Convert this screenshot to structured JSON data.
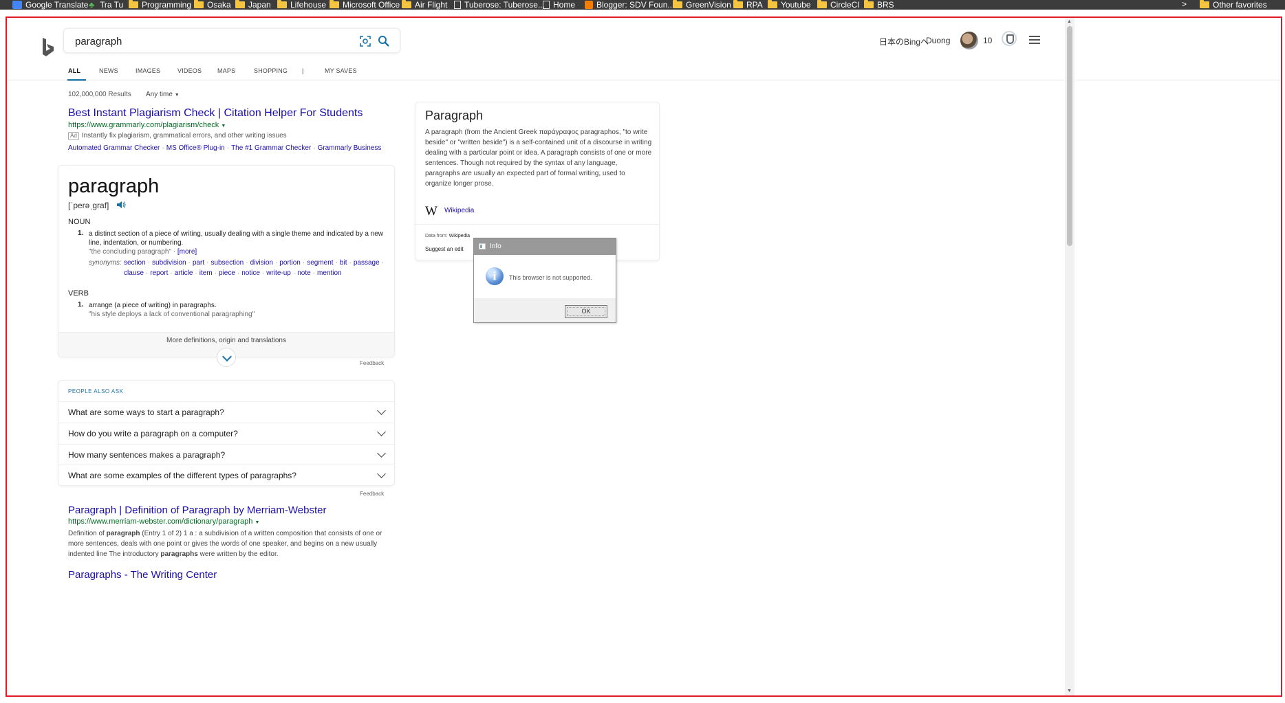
{
  "bookmarks": {
    "items": [
      {
        "label": "Google Translate",
        "icon": "google-translate-icon"
      },
      {
        "label": "Tra Tu",
        "icon": "tree-icon"
      },
      {
        "label": "Programming",
        "icon": "folder-icon"
      },
      {
        "label": "Osaka",
        "icon": "folder-icon"
      },
      {
        "label": "Japan",
        "icon": "folder-icon"
      },
      {
        "label": "Lifehouse",
        "icon": "folder-icon"
      },
      {
        "label": "Microsoft Office",
        "icon": "folder-icon"
      },
      {
        "label": "Air Flight",
        "icon": "folder-icon"
      },
      {
        "label": "Tuberose: Tuberose...",
        "icon": "page-icon"
      },
      {
        "label": "Home",
        "icon": "page-icon"
      },
      {
        "label": "Blogger: SDV Foun...",
        "icon": "blogger-icon"
      },
      {
        "label": "GreenVision",
        "icon": "folder-icon"
      },
      {
        "label": "RPA",
        "icon": "folder-icon"
      },
      {
        "label": "Youtube",
        "icon": "folder-icon"
      },
      {
        "label": "CircleCI",
        "icon": "folder-icon"
      },
      {
        "label": "BRS",
        "icon": "folder-icon"
      }
    ],
    "more": ">",
    "other_favorites": "Other favorites"
  },
  "header": {
    "query": "paragraph",
    "language_link": "日本のBingへ",
    "user_name": "Duong",
    "rewards_count": "10"
  },
  "tabs": [
    "ALL",
    "NEWS",
    "IMAGES",
    "VIDEOS",
    "MAPS",
    "SHOPPING",
    "|",
    "MY SAVES"
  ],
  "results_info": {
    "count": "102,000,000 Results",
    "time_filter": "Any time"
  },
  "ad": {
    "title": "Best Instant Plagiarism Check | Citation Helper For Students",
    "url": "https://www.grammarly.com/plagiarism/check",
    "badge": "Ad",
    "description": "Instantly fix plagiarism, grammatical errors, and other writing issues",
    "links": [
      "Automated Grammar Checker",
      "MS Office® Plug-in",
      "The #1 Grammar Checker",
      "Grammarly Business"
    ]
  },
  "dictionary": {
    "word": "paragraph",
    "pronunciation": "[ˈperəˌɡraf]",
    "noun_label": "NOUN",
    "noun_def": "a distinct section of a piece of writing, usually dealing with a single theme and indicated by a new line, indentation, or numbering.",
    "noun_example": "\"the concluding paragraph\" ·",
    "more_link": "[more]",
    "synonyms_label": "synonyms:",
    "synonyms_row1": [
      "section",
      "subdivision",
      "part",
      "subsection",
      "division",
      "portion",
      "segment",
      "bit",
      "passage"
    ],
    "synonyms_row2": [
      "clause",
      "report",
      "article",
      "item",
      "piece",
      "notice",
      "write-up",
      "note",
      "mention"
    ],
    "verb_label": "VERB",
    "verb_def": "arrange (a piece of writing) in paragraphs.",
    "verb_example": "\"his style deploys a lack of conventional paragraphing\"",
    "def_number": "1.",
    "more_definitions": "More definitions, origin and translations",
    "feedback": "Feedback"
  },
  "people_also_ask": {
    "title": "PEOPLE ALSO ASK",
    "questions": [
      "What are some ways to start a paragraph?",
      "How do you write a paragraph on a computer?",
      "How many sentences makes a paragraph?",
      "What are some examples of the different types of paragraphs?"
    ],
    "feedback": "Feedback"
  },
  "merriam_webster": {
    "title": "Paragraph | Definition of Paragraph by Merriam-Webster",
    "url": "https://www.merriam-webster.com/dictionary/paragraph",
    "desc_prefix": "Definition of ",
    "desc_bold1": "paragraph",
    "desc_mid": " (Entry 1 of 2) 1 a : a subdivision of a written composition that consists of one or more sentences, deals with one point or gives the words of one speaker, and begins on a new usually indented line The introductory ",
    "desc_bold2": "paragraphs",
    "desc_suffix": " were written by the editor."
  },
  "next_result": {
    "title": "Paragraphs - The Writing Center"
  },
  "knowledge_card": {
    "title": "Paragraph",
    "description": "A paragraph (from the Ancient Greek παράγραφος paragraphos, \"to write beside\" or \"written beside\") is a self-contained unit of a discourse in writing dealing with a particular point or idea. A paragraph consists of one or more sentences. Though not required by the syntax of any language, paragraphs are usually an expected part of formal writing, used to organize longer prose.",
    "source_logo": "W",
    "source_link": "Wikipedia",
    "data_from_label": "Data from: ",
    "data_from_source": "Wikipedia",
    "suggest_edit": "Suggest an edit"
  },
  "dialog": {
    "title": "Info",
    "message": "This browser is not supported.",
    "info_glyph": "i",
    "ok_label": "OK"
  },
  "colors": {
    "link": "#1a0dab",
    "url_green": "#006d21",
    "accent": "#1a73a8",
    "frame_red": "#e01b24",
    "dialog_title": "#999999"
  }
}
